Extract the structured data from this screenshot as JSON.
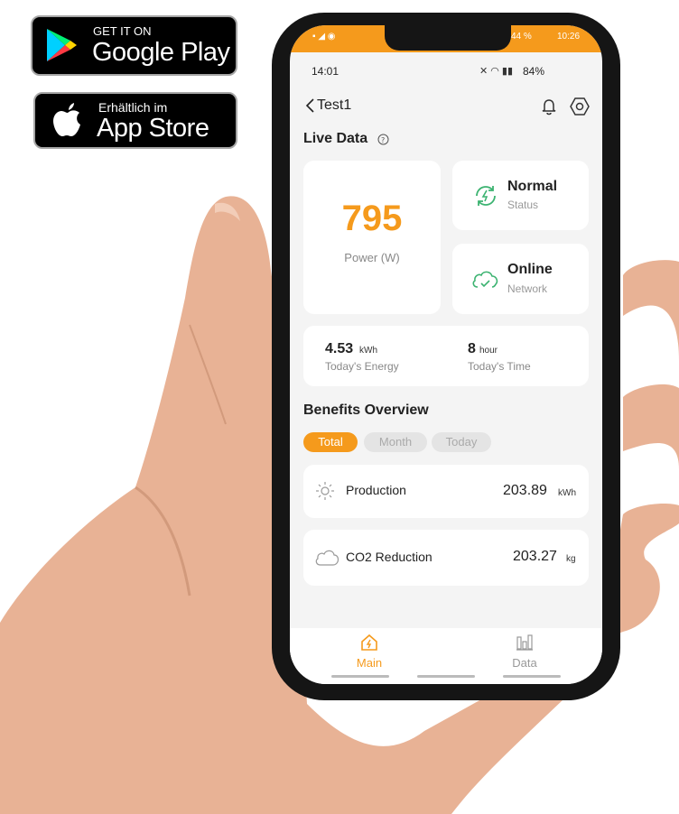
{
  "badges": {
    "google_play": {
      "small": "GET IT ON",
      "big": "Google Play"
    },
    "app_store": {
      "small": "Erhältlich im",
      "big": "App Store"
    }
  },
  "os_status": {
    "left": "14:01",
    "right": "84%",
    "outer_battery": "44 %",
    "outer_time": "10:26"
  },
  "header": {
    "back_icon": "chevron-left-icon",
    "title": "Test1",
    "bell_icon": "bell-icon",
    "settings_icon": "hexagon-settings-icon"
  },
  "live_data": {
    "title": "Live Data",
    "help_icon": "help-circle-icon",
    "power": {
      "value": "795",
      "label": "Power (W)"
    },
    "status": {
      "value": "Normal",
      "label": "Status",
      "icon": "sync-status-icon"
    },
    "network": {
      "value": "Online",
      "label": "Network",
      "icon": "cloud-check-icon"
    },
    "energy": {
      "value": "4.53",
      "unit": "kWh",
      "label": "Today's Energy"
    },
    "time": {
      "value": "8",
      "unit": "hour",
      "label": "Today's Time"
    }
  },
  "benefits": {
    "title": "Benefits Overview",
    "tabs": [
      "Total",
      "Month",
      "Today"
    ],
    "active_tab": "Total",
    "production": {
      "label": "Production",
      "value": "203.89",
      "unit": "kWh",
      "icon": "sun-icon"
    },
    "co2": {
      "label": "CO2 Reduction",
      "value": "203.27",
      "unit": "kg",
      "icon": "cloud-icon"
    }
  },
  "nav": {
    "main": "Main",
    "data": "Data"
  },
  "colors": {
    "accent": "#f59a1c",
    "status_green": "#3cb371"
  }
}
